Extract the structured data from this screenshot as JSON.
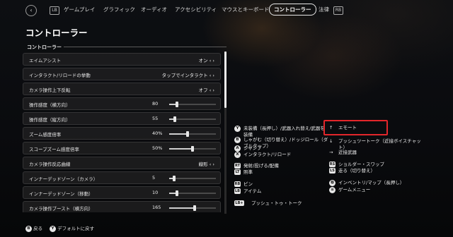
{
  "topbar": {
    "back_icon": "‹",
    "lb": "LB",
    "rb": "RB",
    "tabs": [
      "ゲームプレイ",
      "グラフィック",
      "オーディオ",
      "アクセシビリティ",
      "マウスとキーボード",
      "コントローラー",
      "法律"
    ]
  },
  "page_title": "コントローラー",
  "section_label": "コントローラー",
  "settings": [
    {
      "label": "エイムアシスト",
      "value": "オン"
    },
    {
      "label": "インタラクト/リロードの挙動",
      "value": "タップでインタラクト"
    },
    {
      "label": "カメラ操作上下反転",
      "value": "オフ"
    },
    {
      "label": "操作感度（横方向）",
      "value": "80",
      "fraction": 0.17
    },
    {
      "label": "操作感度（縦方向）",
      "value": "55",
      "fraction": 0.12
    },
    {
      "label": "ズーム感度倍率",
      "value": "40%",
      "fraction": 0.4
    },
    {
      "label": "スコープズーム感度倍率",
      "value": "50%",
      "fraction": 0.5
    },
    {
      "label": "カメラ操作反応曲線",
      "value": "線形"
    },
    {
      "label": "インナーデッドゾーン（カメラ）",
      "value": "5",
      "fraction": 0.1
    },
    {
      "label": "インナーデッドゾーン（移動）",
      "value": "10",
      "fraction": 0.16
    },
    {
      "label": "カメラ操作ブースト（横方向）",
      "value": "165",
      "fraction": 0.55
    }
  ],
  "mappings_left": [
    {
      "button": "Y",
      "text": "未装備（長押し）/武器入れ替え/武器を\n装備"
    },
    {
      "button": "B",
      "text": "しゃがむ（切り替え）/ドッジロール（ダ\nブルタップ）"
    },
    {
      "button": "A",
      "text": "ジャンプ"
    },
    {
      "button": "X",
      "text": "インタラクト/リロード"
    },
    {
      "button": "RT",
      "text": "発射/投げる/配備"
    },
    {
      "button": "LT",
      "text": "照準"
    },
    {
      "button": "RB",
      "text": "ピン"
    },
    {
      "button": "LB",
      "text": "アイテム"
    },
    {
      "button": "LB+",
      "text": "プッシュ・トゥ・トーク"
    }
  ],
  "mappings_right": [
    {
      "button": "↑",
      "text": "エモート"
    },
    {
      "button": "↓",
      "text": "プッシュツートーク（近接ボイスチャッ\nト）"
    },
    {
      "button": "→",
      "text": "近接武器"
    },
    {
      "button": "RS",
      "text": "ショルダー・スワップ"
    },
    {
      "button": "LS",
      "text": "走る（切り替え）"
    },
    {
      "button": "⧉",
      "text": "インベントリ/マップ（長押し）"
    },
    {
      "button": "≡",
      "text": "ゲームメニュー"
    }
  ],
  "footer": {
    "back_button": "B",
    "back_label": "戻る",
    "reset_button": "Y",
    "reset_label": "デフォルトに戻す"
  }
}
